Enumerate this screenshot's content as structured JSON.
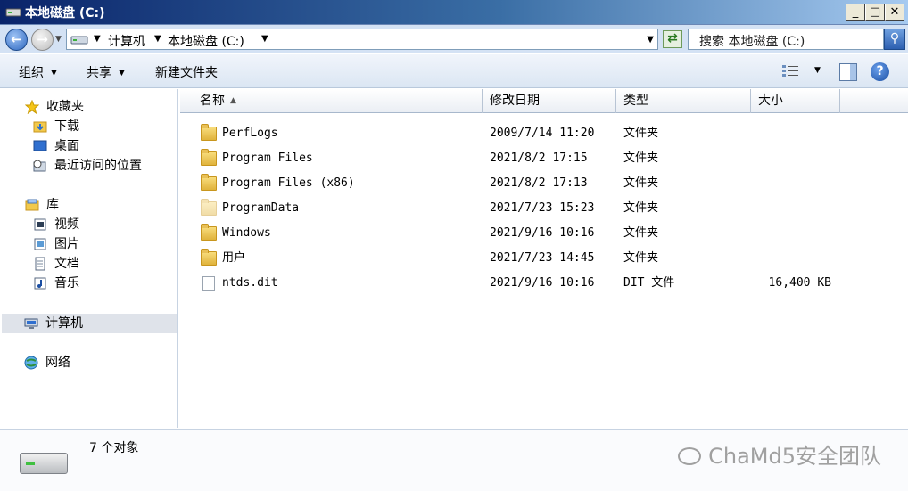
{
  "window": {
    "title": "本地磁盘 (C:)",
    "minimize_glyph": "_",
    "maximize_glyph": "□",
    "close_glyph": "✕"
  },
  "address": {
    "segments": [
      "计算机",
      "本地磁盘 (C:)"
    ],
    "search_placeholder": "搜索 本地磁盘 (C:)"
  },
  "toolbar": {
    "organize": "组织",
    "share": "共享",
    "new_folder": "新建文件夹",
    "help_glyph": "?"
  },
  "sidebar": {
    "favorites": {
      "label": "收藏夹",
      "items": [
        "下载",
        "桌面",
        "最近访问的位置"
      ]
    },
    "libraries": {
      "label": "库",
      "items": [
        "视频",
        "图片",
        "文档",
        "音乐"
      ]
    },
    "computer": "计算机",
    "network": "网络"
  },
  "columns": [
    "名称",
    "修改日期",
    "类型",
    "大小"
  ],
  "files": [
    {
      "name": "PerfLogs",
      "date": "2009/7/14 11:20",
      "type": "文件夹",
      "size": "",
      "icon": "folder-icon"
    },
    {
      "name": "Program Files",
      "date": "2021/8/2 17:15",
      "type": "文件夹",
      "size": "",
      "icon": "folder-icon"
    },
    {
      "name": "Program Files (x86)",
      "date": "2021/8/2 17:13",
      "type": "文件夹",
      "size": "",
      "icon": "folder-icon"
    },
    {
      "name": "ProgramData",
      "date": "2021/7/23 15:23",
      "type": "文件夹",
      "size": "",
      "icon": "folder-icon"
    },
    {
      "name": "Windows",
      "date": "2021/9/16 10:16",
      "type": "文件夹",
      "size": "",
      "icon": "folder-icon"
    },
    {
      "name": "用户",
      "date": "2021/7/23 14:45",
      "type": "文件夹",
      "size": "",
      "icon": "folder-icon"
    },
    {
      "name": "ntds.dit",
      "date": "2021/9/16 10:16",
      "type": "DIT 文件",
      "size": "16,400 KB",
      "icon": "file-icon"
    }
  ],
  "status": {
    "count_text": "7 个对象",
    "watermark": "ChaMd5安全团队"
  }
}
